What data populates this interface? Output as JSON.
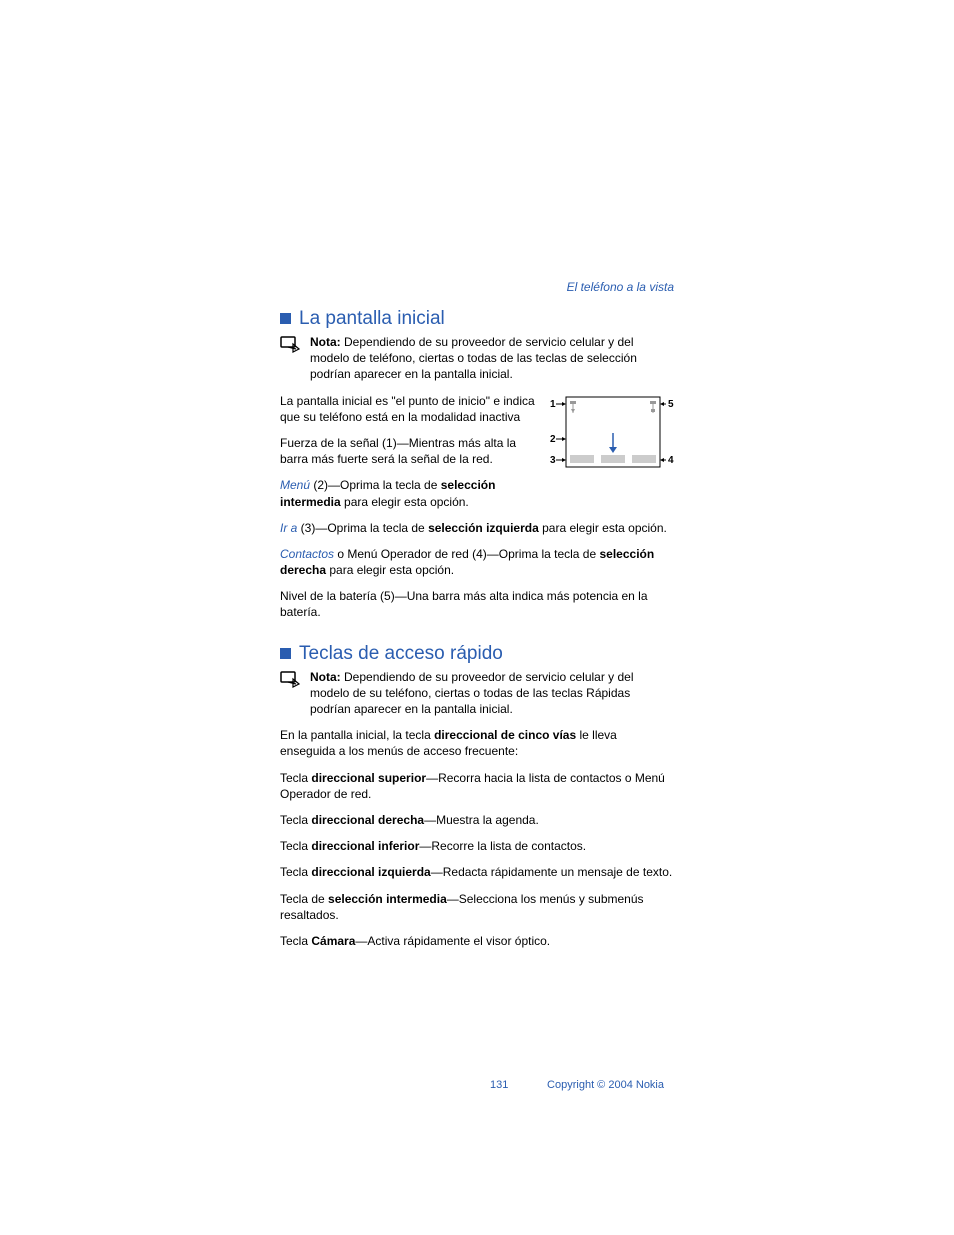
{
  "header_link": "El teléfono a la vista",
  "section1": {
    "title": "La pantalla inicial",
    "note_label": "Nota:",
    "note_text": " Dependiendo de su proveedor de servicio celular y del modelo de teléfono, ciertas o todas de las teclas de selección podrían aparecer en la pantalla inicial.",
    "p1": "La pantalla inicial es \"el punto de inicio\" e indica que su teléfono está en la modalidad inactiva",
    "p2": "Fuerza de la señal (1)—Mientras más alta la barra más fuerte será la señal de la red.",
    "p3_link": "Menú",
    "p3_rest_a": " (2)—Oprima la tecla de ",
    "p3_bold": "selección intermedia",
    "p3_rest_b": " para elegir esta opción.",
    "p4_link": "Ir a",
    "p4_rest_a": " (3)—Oprima la tecla de ",
    "p4_bold": "selección izquierda",
    "p4_rest_b": " para elegir esta opción.",
    "p5_link": "Contactos",
    "p5_rest_a": " o Menú Operador de red (4)—Oprima la tecla de ",
    "p5_bold": "selección derecha",
    "p5_rest_b": " para elegir esta opción.",
    "p6": "Nivel de la batería (5)—Una barra más alta indica más potencia en la batería."
  },
  "section2": {
    "title": "Teclas de acceso rápido",
    "note_label": "Nota:",
    "note_text": " Dependiendo de su proveedor de servicio celular y del modelo de su teléfono, ciertas o todas de las teclas Rápidas podrían aparecer en la pantalla inicial.",
    "p1_a": "En la pantalla inicial, la tecla ",
    "p1_bold": "direccional de cinco vías",
    "p1_b": " le lleva enseguida a los menús de acceso frecuente:",
    "p2_a": "Tecla ",
    "p2_bold": "direccional superior",
    "p2_b": "—Recorra hacia la lista de contactos o Menú Operador de red.",
    "p3_a": "Tecla ",
    "p3_bold": "direccional derecha",
    "p3_b": "—Muestra la agenda.",
    "p4_a": "Tecla ",
    "p4_bold": "direccional inferior",
    "p4_b": "—Recorre la lista de contactos.",
    "p5_a": "Tecla ",
    "p5_bold": "direccional izquierda",
    "p5_b": "—Redacta rápidamente un mensaje de texto.",
    "p6_a": "Tecla de ",
    "p6_bold": "selección intermedia",
    "p6_b": "—Selecciona los menús y submenús resaltados.",
    "p7_a": "Tecla ",
    "p7_bold": "Cámara",
    "p7_b": "—Activa rápidamente el visor óptico."
  },
  "diagram": {
    "l1": "1",
    "l2": "2",
    "l3": "3",
    "l4": "4",
    "l5": "5"
  },
  "footer": {
    "page": "131",
    "copyright": "Copyright © 2004 Nokia"
  }
}
